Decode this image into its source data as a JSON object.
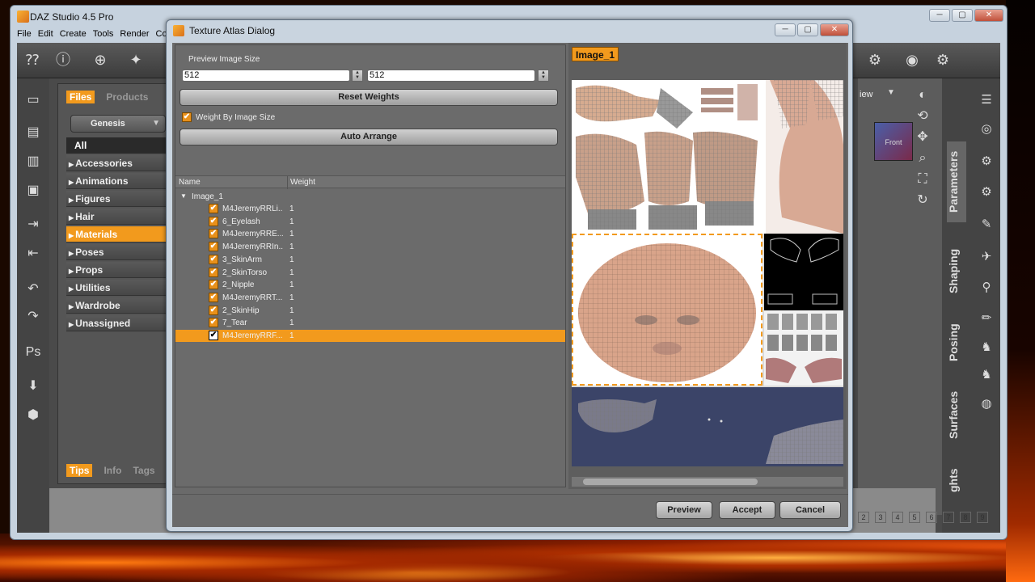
{
  "app": {
    "title": "DAZ Studio 4.5 Pro",
    "menu": [
      "File",
      "Edit",
      "Create",
      "Tools",
      "Render",
      "Co"
    ]
  },
  "left_panel": {
    "tabs": [
      "Files",
      "Products"
    ],
    "figure_select": "Genesis",
    "all_label": "All",
    "categories": [
      "Accessories",
      "Animations",
      "Figures",
      "Hair",
      "Materials",
      "Poses",
      "Props",
      "Utilities",
      "Wardrobe",
      "Unassigned"
    ],
    "selected_category": "Materials",
    "bottom_tabs": [
      "Tips",
      "Info",
      "Tags"
    ]
  },
  "right_tabs": [
    "Parameters",
    "Shaping",
    "Posing",
    "Surfaces",
    "ghts"
  ],
  "viewport": {
    "view_label": "iew",
    "cube_label": "Front"
  },
  "frame_numbers": [
    "2",
    "3",
    "4",
    "5",
    "6",
    "7",
    "8",
    "9"
  ],
  "dialog": {
    "title": "Texture Atlas Dialog",
    "preview_size_label": "Preview Image Size",
    "width_value": "512",
    "height_value": "512",
    "reset_weights": "Reset Weights",
    "weight_by_size": "Weight By Image Size",
    "weight_by_size_checked": true,
    "auto_arrange": "Auto Arrange",
    "columns": [
      "Name",
      "Weight"
    ],
    "root_node": "Image_1",
    "rows": [
      {
        "name": "M4JeremyRRLi...",
        "weight": "1",
        "selected": false
      },
      {
        "name": "6_Eyelash",
        "weight": "1",
        "selected": false
      },
      {
        "name": "M4JeremyRRE...",
        "weight": "1",
        "selected": false
      },
      {
        "name": "M4JeremyRRIn...",
        "weight": "1",
        "selected": false
      },
      {
        "name": "3_SkinArm",
        "weight": "1",
        "selected": false
      },
      {
        "name": "2_SkinTorso",
        "weight": "1",
        "selected": false
      },
      {
        "name": "2_Nipple",
        "weight": "1",
        "selected": false
      },
      {
        "name": "M4JeremyRRT...",
        "weight": "1",
        "selected": false
      },
      {
        "name": "2_SkinHip",
        "weight": "1",
        "selected": false
      },
      {
        "name": "7_Tear",
        "weight": "1",
        "selected": false
      },
      {
        "name": "M4JeremyRRF...",
        "weight": "1",
        "selected": true
      }
    ],
    "image_tab": "Image_1",
    "buttons": {
      "preview": "Preview",
      "accept": "Accept",
      "cancel": "Cancel"
    },
    "colors": {
      "accent": "#f29a1d",
      "skin": "#d9a48a",
      "navy": "#3b4468"
    }
  }
}
